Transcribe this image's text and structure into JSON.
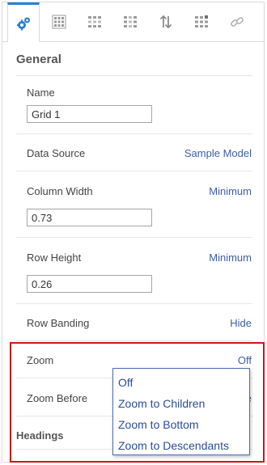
{
  "tabs": [
    {
      "icon": "gears-icon",
      "active": true
    },
    {
      "icon": "grid-icon",
      "active": false
    },
    {
      "icon": "grid-dots-icon",
      "active": false
    },
    {
      "icon": "grid-columns-icon",
      "active": false
    },
    {
      "icon": "sort-arrows-icon",
      "active": false
    },
    {
      "icon": "grid-corner-icon",
      "active": false
    },
    {
      "icon": "link-icon",
      "active": false
    }
  ],
  "general": {
    "title": "General",
    "name_label": "Name",
    "name_value": "Grid 1",
    "data_source_label": "Data Source",
    "data_source_value": "Sample Model",
    "column_width_label": "Column Width",
    "column_width_option": "Minimum",
    "column_width_value": "0.73",
    "row_height_label": "Row Height",
    "row_height_option": "Minimum",
    "row_height_value": "0.26",
    "row_banding_label": "Row Banding",
    "row_banding_value": "Hide",
    "zoom_label": "Zoom",
    "zoom_value": "Off",
    "zoom_before_label": "Zoom Before",
    "zoom_before_value_partial": "e"
  },
  "headings_title": "Headings",
  "zoom_menu": {
    "options": [
      "Off",
      "Zoom to Children",
      "Zoom to Bottom",
      "Zoom to Descendants"
    ]
  },
  "colors": {
    "accent": "#2c7fd6",
    "link": "#3b5ea8",
    "highlight": "#d0151b"
  }
}
